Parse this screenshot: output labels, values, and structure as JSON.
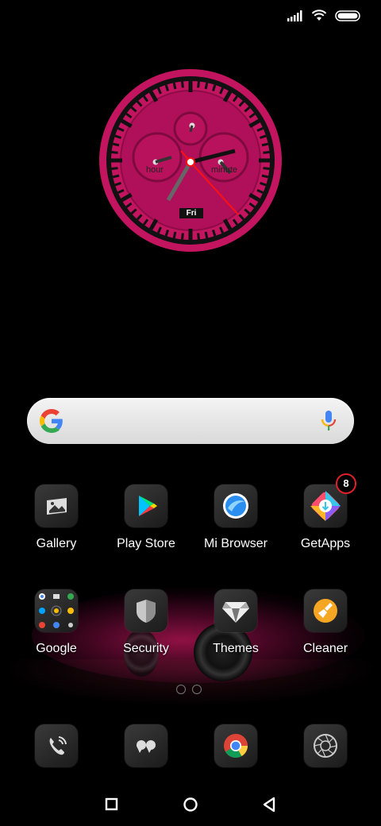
{
  "clock": {
    "subdial_left_label": "hour",
    "subdial_right_label": "minute",
    "day_label": "Fri",
    "accent_color": "#c2145f"
  },
  "search": {
    "google_icon": "google-g-icon",
    "mic_icon": "google-mic-icon"
  },
  "apps_row1": [
    {
      "label": "Gallery",
      "icon": "gallery-icon"
    },
    {
      "label": "Play Store",
      "icon": "play-store-icon"
    },
    {
      "label": "Mi Browser",
      "icon": "mi-browser-icon"
    },
    {
      "label": "GetApps",
      "icon": "getapps-icon",
      "badge": "8"
    }
  ],
  "apps_row2": [
    {
      "label": "Google",
      "icon": "google-folder-icon"
    },
    {
      "label": "Security",
      "icon": "security-shield-icon"
    },
    {
      "label": "Themes",
      "icon": "themes-icon"
    },
    {
      "label": "Cleaner",
      "icon": "cleaner-brush-icon"
    }
  ],
  "dock": [
    {
      "icon": "phone-icon"
    },
    {
      "icon": "messages-icon"
    },
    {
      "icon": "chrome-icon"
    },
    {
      "icon": "camera-icon"
    }
  ],
  "navigation": [
    "recents-button",
    "home-button",
    "back-button"
  ],
  "colors": {
    "badge_ring": "#e0202a",
    "background": "#000000"
  }
}
